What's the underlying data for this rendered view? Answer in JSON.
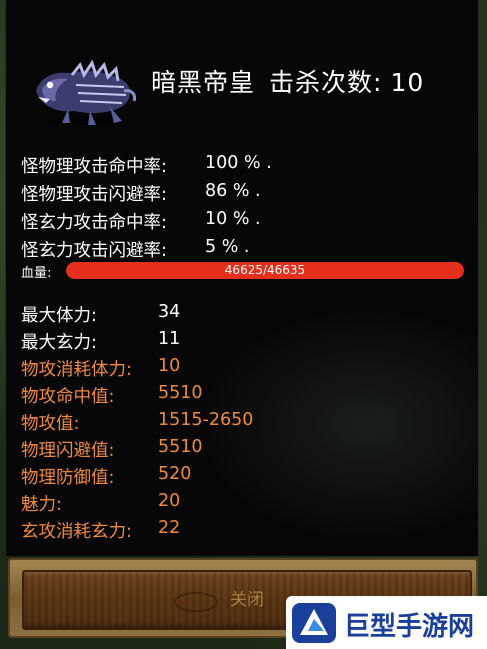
{
  "monster": {
    "name": "暗黑帝皇",
    "kill_label": "击杀次数:",
    "kill_count": "10"
  },
  "rates": [
    {
      "label": "怪物理攻击命中率:",
      "value": "100 % ."
    },
    {
      "label": "怪物理攻击闪避率:",
      "value": "86 % ."
    },
    {
      "label": "怪玄力攻击命中率:",
      "value": "10 % ."
    },
    {
      "label": "怪玄力攻击闪避率:",
      "value": "5 % ."
    }
  ],
  "hp": {
    "label": "血量:",
    "text": "46625/46635",
    "current": 46625,
    "max": 46635
  },
  "stats": [
    {
      "label": "最大体力:",
      "value": "34",
      "color": "white"
    },
    {
      "label": "最大玄力:",
      "value": "11",
      "color": "white"
    },
    {
      "label": "物攻消耗体力:",
      "value": "10",
      "color": "orange"
    },
    {
      "label": "物攻命中值:",
      "value": "5510",
      "color": "orange"
    },
    {
      "label": "物攻值:",
      "value": "1515-2650",
      "color": "orange"
    },
    {
      "label": "物理闪避值:",
      "value": "5510",
      "color": "orange"
    },
    {
      "label": "物理防御值:",
      "value": "520",
      "color": "orange"
    },
    {
      "label": "魅力:",
      "value": "20",
      "color": "orange"
    },
    {
      "label": "玄攻消耗玄力:",
      "value": "22",
      "color": "orange"
    }
  ],
  "close_button": {
    "label": "关闭"
  },
  "watermark": {
    "text": "巨型手游网"
  },
  "colors": {
    "panel_bg": "#070707",
    "stat_orange": "#f08a3a",
    "hp_bar": "#e42f1c",
    "watermark_blue": "#1a3f9a"
  },
  "icons": [
    "monster-portrait-icon",
    "watermark-logo-icon"
  ]
}
